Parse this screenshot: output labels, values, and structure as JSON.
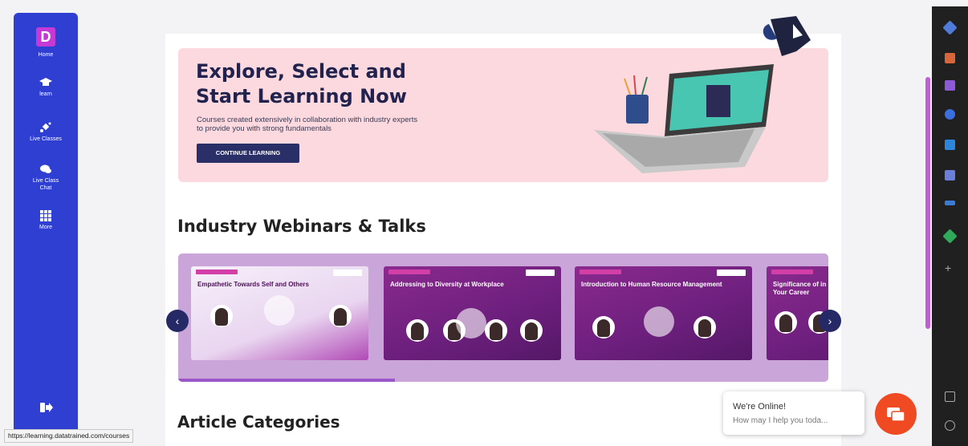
{
  "nav": {
    "logo_letter": "D",
    "items": [
      {
        "label": "Home",
        "icon": "home-logo"
      },
      {
        "label": "learn",
        "icon": "graduation-cap-icon"
      },
      {
        "label": "Live Classes",
        "icon": "satellite-icon"
      },
      {
        "label": "Live Class Chat",
        "icon": "chat-bubbles-icon"
      },
      {
        "label": "More",
        "icon": "grid-icon"
      }
    ],
    "logout_icon": "logout-icon"
  },
  "hero": {
    "title_line1": "Explore, Select and",
    "title_line2": "Start Learning Now",
    "subtitle_line1": "Courses created extensively in collaboration with industry experts",
    "subtitle_line2": "to provide you with strong fundamentals",
    "button": "CONTINUE LEARNING"
  },
  "webinars": {
    "title": "Industry Webinars & Talks",
    "cards": [
      {
        "title": "Empathetic Towards Self and Others"
      },
      {
        "title": "Addressing to Diversity at Workplace"
      },
      {
        "title": "Introduction to Human Resource Management"
      },
      {
        "title": "Significance of in Your Career"
      }
    ],
    "progress": 0.33
  },
  "articles": {
    "title": "Article Categories"
  },
  "chat": {
    "title": "We're Online!",
    "subtitle": "How may I help you toda..."
  },
  "status_url": "https://learning.datatrained.com/courses",
  "colors": {
    "nav": "#2f3fd2",
    "hero": "#fbd9de",
    "accent": "#c53ad6",
    "chat_button": "#f04a23"
  }
}
